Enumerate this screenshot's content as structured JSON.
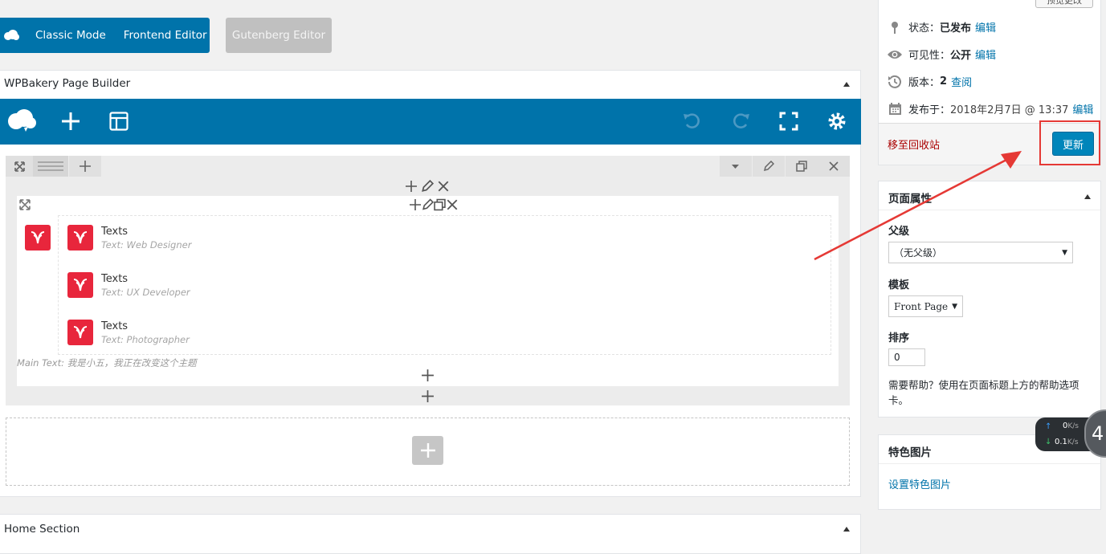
{
  "editor_modes": {
    "classic": "Classic Mode",
    "frontend": "Frontend Editor",
    "gutenberg": "Gutenberg Editor"
  },
  "builder": {
    "title": "WPBakery Page Builder",
    "elements": [
      {
        "title": "Texts",
        "subtitle": "Text: Web Designer"
      },
      {
        "title": "Texts",
        "subtitle": "Text: UX Developer"
      },
      {
        "title": "Texts",
        "subtitle": "Text: Photographer"
      }
    ],
    "main_text": "Main Text: 我是小五，我正在改变这个主题"
  },
  "home_section": {
    "title": "Home Section"
  },
  "publish": {
    "corner_button": "预览更改",
    "status_label": "状态：",
    "status_value": "已发布",
    "visibility_label": "可见性：",
    "visibility_value": "公开",
    "revisions_label": "版本：",
    "revisions_value": "2",
    "revisions_link": "查阅",
    "published_label": "发布于：",
    "published_value": "2018年2月7日 @ 13:37",
    "edit_link": "编辑",
    "trash": "移至回收站",
    "update": "更新"
  },
  "page_attributes": {
    "title": "页面属性",
    "parent_label": "父级",
    "parent_value": "（无父级）",
    "template_label": "模板",
    "template_value": "Front Page",
    "order_label": "排序",
    "order_value": "0",
    "help": "需要帮助？使用在页面标题上方的帮助选项卡。"
  },
  "featured_image": {
    "title": "特色图片",
    "link": "设置特色图片"
  },
  "speed_widget": {
    "up": "0",
    "up_unit": "K/s",
    "down": "0.1",
    "down_unit": "K/s",
    "count": "4"
  },
  "colors": {
    "accent": "#0073aa",
    "danger": "#e53935",
    "logo": "#e8263c"
  }
}
